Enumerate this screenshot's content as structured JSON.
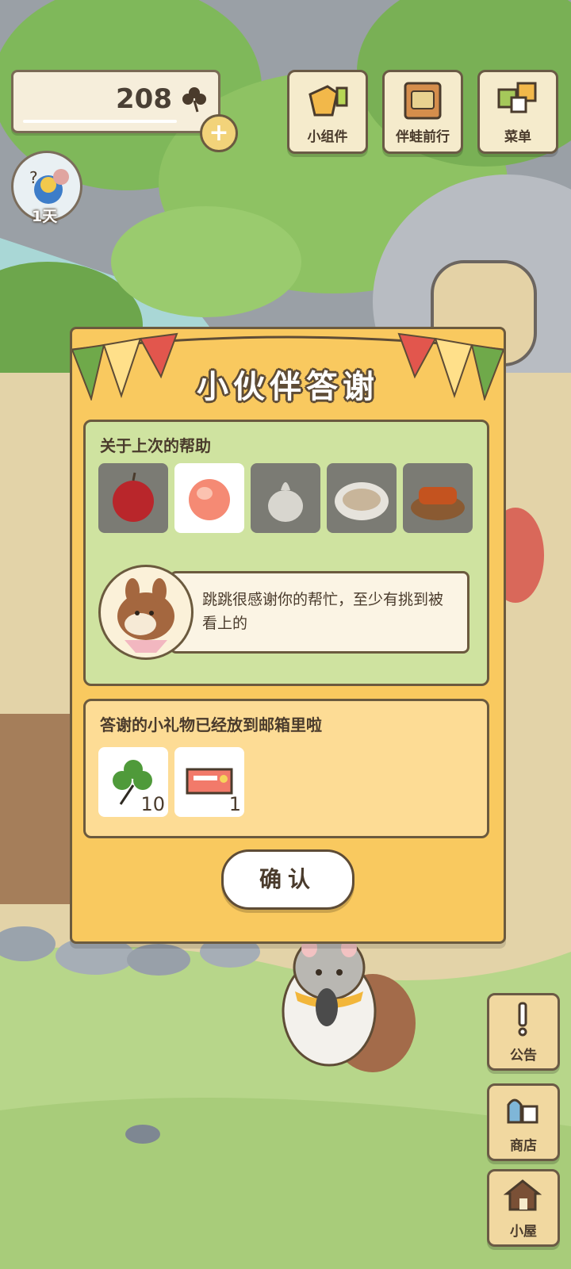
{
  "hud": {
    "clover_count": "208",
    "day_label": "1天",
    "top_buttons": [
      {
        "label": "小组件",
        "icon": "widget-icon"
      },
      {
        "label": "伴蛙前行",
        "icon": "frog-journey-icon"
      },
      {
        "label": "菜单",
        "icon": "menu-icon"
      }
    ],
    "side_buttons": [
      {
        "label": "公告",
        "icon": "notice-icon"
      },
      {
        "label": "商店",
        "icon": "shop-icon"
      },
      {
        "label": "小屋",
        "icon": "house-icon"
      }
    ]
  },
  "dialog": {
    "title": "小伙伴答谢",
    "help_heading": "关于上次的帮助",
    "foods": [
      {
        "name": "apple",
        "selected": false
      },
      {
        "name": "peach",
        "selected": true
      },
      {
        "name": "garlic",
        "selected": false
      },
      {
        "name": "noodle-dish",
        "selected": false
      },
      {
        "name": "roasted-skewers",
        "selected": false
      }
    ],
    "speech": "跳跳很感谢你的帮忙，至少有挑到被看上的",
    "gift_heading": "答谢的小礼物已经放到邮箱里啦",
    "gifts": [
      {
        "name": "clover",
        "qty": "10"
      },
      {
        "name": "ticket",
        "qty": "1"
      }
    ],
    "confirm_label": "确认"
  },
  "colors": {
    "dialog_bg": "#f9c95f",
    "help_panel_bg": "#cfe3a0",
    "gift_panel_bg": "#fddc95",
    "outline": "#6b5a3e"
  }
}
